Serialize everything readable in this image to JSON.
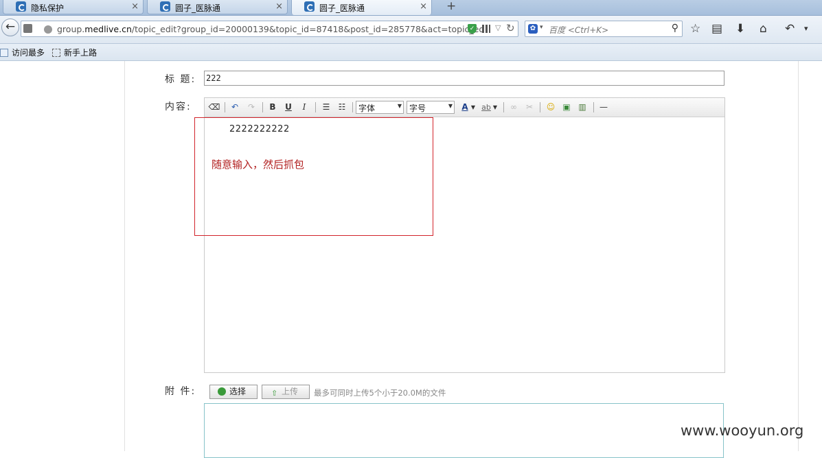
{
  "browser": {
    "tabs": [
      {
        "title": "隐私保护",
        "close": "×"
      },
      {
        "title": "圆子_医脉通",
        "close": "×"
      },
      {
        "title": "圆子_医脉通",
        "close": "×"
      }
    ],
    "new_tab": "+",
    "url_domain_prefix": "group.",
    "url_domain_main": "medlive.cn",
    "url_path": "/topic_edit?group_id=20000139&topic_id=87418&post_id=285778&act=topic_edit",
    "search_placeholder": "百度 <Ctrl+K>",
    "bookmarks": [
      "访问最多",
      "新手上路"
    ]
  },
  "form": {
    "title_label": "标 题:",
    "title_value": "222",
    "content_label": "内容:",
    "font_select": "字体",
    "size_select": "字号",
    "content_text": "2222222222",
    "attachment_label": "附 件:",
    "select_button": "选择",
    "upload_button": "上传",
    "upload_hint": "最多可同时上传5个小于20.0M的文件"
  },
  "annotation": "随意输入，然后抓包",
  "watermark": "www.wooyun.org",
  "colors": {
    "annotation_red": "#d2232a",
    "accent_blue": "#2f6fb5"
  }
}
